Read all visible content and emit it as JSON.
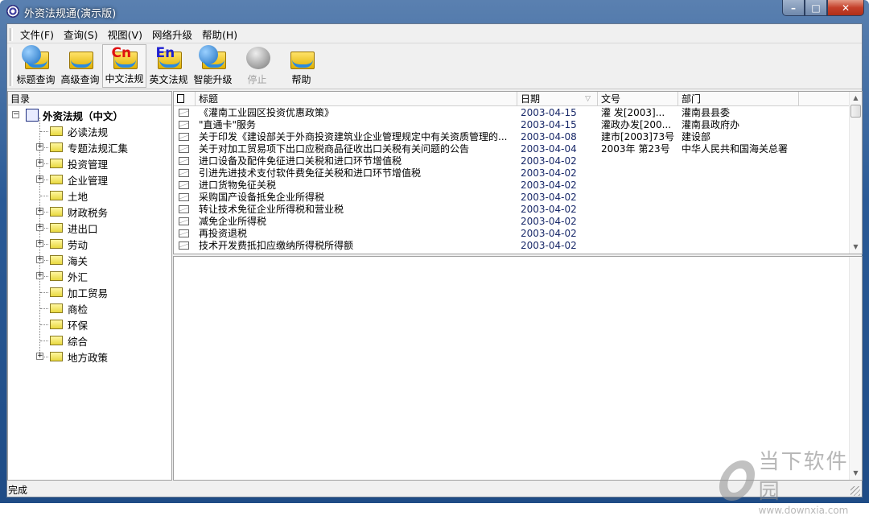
{
  "window": {
    "title": "外资法规通(演示版)",
    "controls": {
      "minimize": "–",
      "maximize": "□",
      "close": "✕"
    }
  },
  "menu": [
    "文件(F)",
    "查询(S)",
    "视图(V)",
    "网络升级",
    "帮助(H)"
  ],
  "toolbar": [
    {
      "label": "标题查询",
      "icon": "globe-folder-icon",
      "state": "normal"
    },
    {
      "label": "高级查询",
      "icon": "folder-arrow-icon",
      "state": "normal"
    },
    {
      "label": "中文法规",
      "icon": "cn-folder-icon",
      "state": "active",
      "icon_text": "Cn"
    },
    {
      "label": "英文法规",
      "icon": "en-folder-icon",
      "state": "normal",
      "icon_text": "En"
    },
    {
      "label": "智能升级",
      "icon": "upgrade-globe-icon",
      "state": "normal"
    },
    {
      "label": "停止",
      "icon": "stop-icon",
      "state": "disabled"
    },
    {
      "label": "帮助",
      "icon": "help-folder-icon",
      "state": "normal"
    }
  ],
  "tree": {
    "header": "目录",
    "root": "外资法规（中文）",
    "items": [
      {
        "label": "必读法规",
        "expandable": false
      },
      {
        "label": "专题法规汇集",
        "expandable": true
      },
      {
        "label": "投资管理",
        "expandable": true
      },
      {
        "label": "企业管理",
        "expandable": true
      },
      {
        "label": "土地",
        "expandable": false
      },
      {
        "label": "财政税务",
        "expandable": true
      },
      {
        "label": "进出口",
        "expandable": true
      },
      {
        "label": "劳动",
        "expandable": true
      },
      {
        "label": "海关",
        "expandable": true
      },
      {
        "label": "外汇",
        "expandable": true
      },
      {
        "label": "加工贸易",
        "expandable": false
      },
      {
        "label": "商检",
        "expandable": false
      },
      {
        "label": "环保",
        "expandable": false
      },
      {
        "label": "综合",
        "expandable": false
      },
      {
        "label": "地方政策",
        "expandable": true
      }
    ]
  },
  "list": {
    "columns": [
      "标题",
      "日期",
      "文号",
      "部门"
    ],
    "sort_indicator": "▽",
    "rows": [
      {
        "title": "《灌南工业园区投资优惠政策》",
        "date": "2003-04-15",
        "doc": "灌  发[2003]...",
        "dept": "灌南县县委"
      },
      {
        "title": "\"直通卡\"服务",
        "date": "2003-04-15",
        "doc": "灌政办发[200...",
        "dept": "灌南县政府办"
      },
      {
        "title": "关于印发《建设部关于外商投资建筑业企业管理规定中有关资质管理的...",
        "date": "2003-04-08",
        "doc": "建市[2003]73号",
        "dept": "建设部"
      },
      {
        "title": "关于对加工贸易项下出口应税商品征收出口关税有关问题的公告",
        "date": "2003-04-04",
        "doc": "2003年 第23号",
        "dept": "中华人民共和国海关总署"
      },
      {
        "title": "进口设备及配件免征进口关税和进口环节增值税",
        "date": "2003-04-02",
        "doc": "",
        "dept": ""
      },
      {
        "title": "引进先进技术支付软件费免征关税和进口环节增值税",
        "date": "2003-04-02",
        "doc": "",
        "dept": ""
      },
      {
        "title": "进口货物免征关税",
        "date": "2003-04-02",
        "doc": "",
        "dept": ""
      },
      {
        "title": "采购国产设备抵免企业所得税",
        "date": "2003-04-02",
        "doc": "",
        "dept": ""
      },
      {
        "title": "转让技术免征企业所得税和营业税",
        "date": "2003-04-02",
        "doc": "",
        "dept": ""
      },
      {
        "title": "减免企业所得税",
        "date": "2003-04-02",
        "doc": "",
        "dept": ""
      },
      {
        "title": "再投资退税",
        "date": "2003-04-02",
        "doc": "",
        "dept": ""
      },
      {
        "title": "技术开发费抵扣应缴纳所得税所得额",
        "date": "2003-04-02",
        "doc": "",
        "dept": ""
      }
    ]
  },
  "status": "完成",
  "watermark": {
    "name": "当下软件园",
    "url": "www.downxia.com"
  }
}
